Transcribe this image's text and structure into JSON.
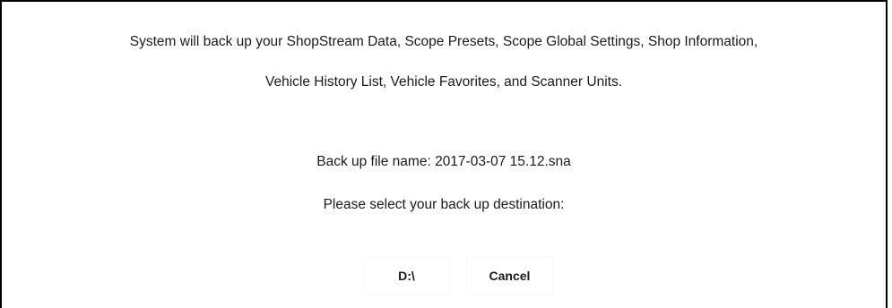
{
  "dialog": {
    "message_line1": "System will back up your ShopStream Data, Scope Presets, Scope Global Settings, Shop Information,",
    "message_line2": "Vehicle History List, Vehicle Favorites, and Scanner Units.",
    "file_name_line": "Back up file name: 2017-03-07 15.12.sna",
    "destination_prompt": "Please select your back up destination:",
    "buttons": {
      "drive_label": "D:\\",
      "cancel_label": "Cancel"
    }
  }
}
